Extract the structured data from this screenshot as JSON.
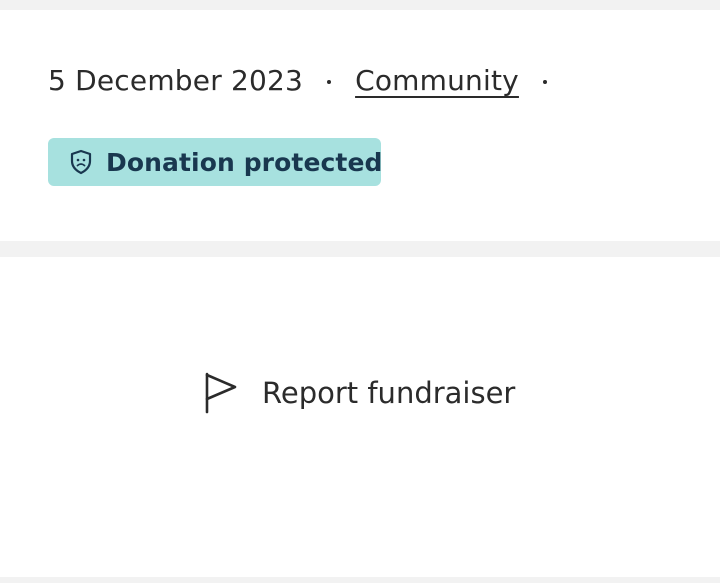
{
  "meta": {
    "date": "5 December 2023",
    "category": "Community"
  },
  "badge": {
    "label": "Donation protected",
    "icon": "shield-icon",
    "background": "#a7e1df",
    "text_color": "#19374f"
  },
  "report": {
    "label": "Report fundraiser",
    "icon": "flag-icon"
  }
}
